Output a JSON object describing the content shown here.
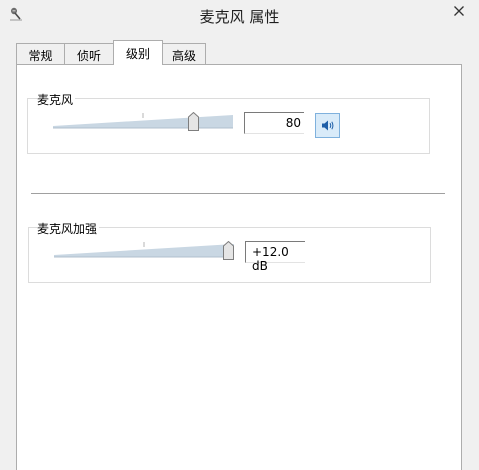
{
  "window": {
    "title": "麦克风 属性",
    "icons": {
      "app": "microphone-icon",
      "close": "close-icon"
    }
  },
  "tabs": [
    {
      "label": "常规",
      "active": false
    },
    {
      "label": "侦听",
      "active": false
    },
    {
      "label": "级别",
      "active": true
    },
    {
      "label": "高级",
      "active": false
    }
  ],
  "levels": {
    "microphone": {
      "label": "麦克风",
      "value": "80",
      "level_fraction": 0.8,
      "speaker_icon": "speaker-icon"
    },
    "boost": {
      "label": "麦克风加强",
      "value": "+12.0 dB",
      "level_fraction": 1.0
    }
  },
  "colors": {
    "accent": "#d9ebf9",
    "accent_border": "#7fb1dd",
    "wedge": "#c9d7e3",
    "panel": "#ffffff",
    "window": "#f0f0f0"
  }
}
